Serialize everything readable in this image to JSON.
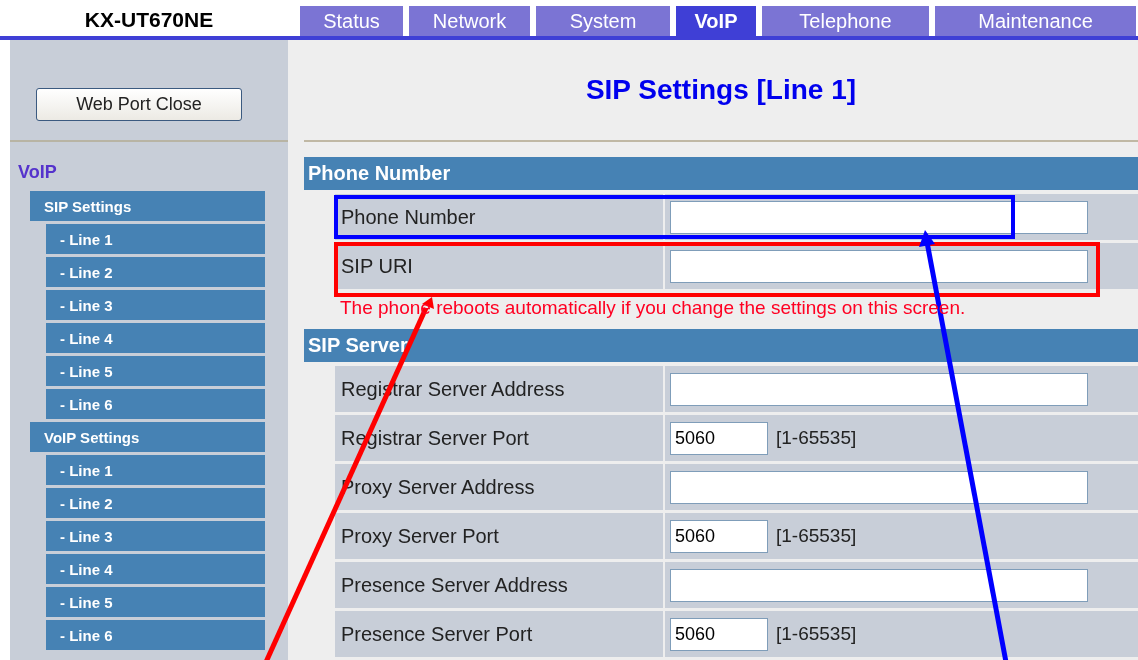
{
  "header": {
    "model": "KX-UT670NE"
  },
  "tabs": [
    {
      "label": "Status",
      "selected": false
    },
    {
      "label": "Network",
      "selected": false
    },
    {
      "label": "System",
      "selected": false
    },
    {
      "label": "VoIP",
      "selected": true
    },
    {
      "label": "Telephone",
      "selected": false
    },
    {
      "label": "Maintenance",
      "selected": false
    }
  ],
  "sidebar": {
    "button": "Web Port Close",
    "title": "VoIP",
    "groups": [
      {
        "label": "SIP Settings",
        "items": [
          "- Line 1",
          "- Line 2",
          "- Line 3",
          "- Line 4",
          "- Line 5",
          "- Line 6"
        ]
      },
      {
        "label": "VoIP Settings",
        "items": [
          "- Line 1",
          "- Line 2",
          "- Line 3",
          "- Line 4",
          "- Line 5",
          "- Line 6"
        ]
      }
    ]
  },
  "page_title": "SIP Settings [Line 1]",
  "sections": [
    {
      "title": "Phone Number",
      "rows": [
        {
          "kind": "text",
          "label": "Phone Number"
        },
        {
          "kind": "text",
          "label": "SIP URI"
        }
      ],
      "note": "The phone reboots automatically if you change the settings on this screen."
    },
    {
      "title": "SIP Server",
      "rows": [
        {
          "kind": "text",
          "label": "Registrar Server Address"
        },
        {
          "kind": "port",
          "label": "Registrar Server Port",
          "value": "5060",
          "range": "[1-65535]"
        },
        {
          "kind": "text",
          "label": "Proxy Server Address"
        },
        {
          "kind": "port",
          "label": "Proxy Server Port",
          "value": "5060",
          "range": "[1-65535]"
        },
        {
          "kind": "text",
          "label": "Presence Server Address"
        },
        {
          "kind": "port",
          "label": "Presence Server Port",
          "value": "5060",
          "range": "[1-65535]"
        }
      ]
    }
  ]
}
